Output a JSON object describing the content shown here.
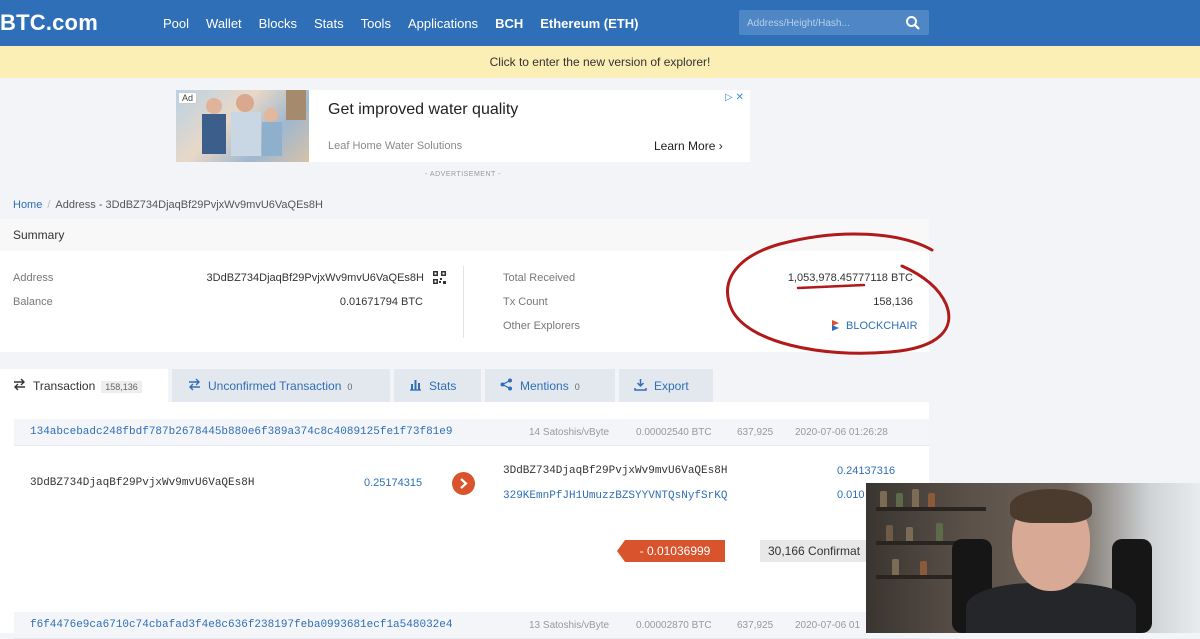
{
  "logo": "BTC.com",
  "nav": [
    {
      "label": "Pool",
      "bold": false
    },
    {
      "label": "Wallet",
      "bold": false
    },
    {
      "label": "Blocks",
      "bold": false
    },
    {
      "label": "Stats",
      "bold": false
    },
    {
      "label": "Tools",
      "bold": false
    },
    {
      "label": "Applications",
      "bold": false
    },
    {
      "label": "BCH",
      "bold": true
    },
    {
      "label": "Ethereum (ETH)",
      "bold": true
    }
  ],
  "search": {
    "placeholder": "Address/Height/Hash..."
  },
  "banner": "Click to enter the new version of explorer!",
  "ad": {
    "tag": "Ad",
    "headline": "Get improved water quality",
    "source": "Leaf Home Water Solutions",
    "cta": "Learn More",
    "close": "▷ ✕",
    "label": "- ADVERTISEMENT -"
  },
  "breadcrumb": {
    "home": "Home",
    "current": "Address - 3DdBZ734DjaqBf29PvjxWv9mvU6VaQEs8H"
  },
  "summary": {
    "title": "Summary",
    "address_label": "Address",
    "address_value": "3DdBZ734DjaqBf29PvjxWv9mvU6VaQEs8H",
    "balance_label": "Balance",
    "balance_value": "0.01671794 BTC",
    "total_received_label": "Total Received",
    "total_received_value": "1,053,978.45777118 BTC",
    "tx_count_label": "Tx Count",
    "tx_count_value": "158,136",
    "other_explorers_label": "Other Explorers",
    "other_explorers_value": "BLOCKCHAIR"
  },
  "tabs": [
    {
      "label": "Transaction",
      "count": "158,136",
      "active": true
    },
    {
      "label": "Unconfirmed Transaction",
      "count": "0",
      "active": false
    },
    {
      "label": "Stats",
      "count": "",
      "active": false
    },
    {
      "label": "Mentions",
      "count": "0",
      "active": false
    },
    {
      "label": "Export",
      "count": "",
      "active": false
    }
  ],
  "transactions": [
    {
      "hash": "134abcebadc248fbdf787b2678445b880e6f389a374c8c4089125fe1f73f81e9",
      "fee_rate": "14 Satoshis/vByte",
      "fee": "0.00002540 BTC",
      "height": "637,925",
      "time": "2020-07-06 01:26:28",
      "input_address": "3DdBZ734DjaqBf29PvjxWv9mvU6VaQEs8H",
      "input_amount": "0.25174315",
      "outputs": [
        {
          "address": "3DdBZ734DjaqBf29PvjxWv9mvU6VaQEs8H",
          "amount": "0.24137316"
        },
        {
          "address": "329KEmnPfJH1UmuzzBZSYYVNTQsNyfSrKQ",
          "amount": "0.010"
        }
      ],
      "balance_change": "- 0.01036999",
      "confirmations": "30,166 Confirmat"
    },
    {
      "hash": "f6f4476e9ca6710c74cbafad3f4e8c636f238197feba0993681ecf1a548032e4",
      "fee_rate": "13 Satoshis/vByte",
      "fee": "0.00002870 BTC",
      "height": "637,925",
      "time": "2020-07-06 01"
    }
  ],
  "colors": {
    "brand": "#2f6fb7",
    "banner": "#fcefb5",
    "negative": "#d9532c",
    "annotation": "#b01a1a"
  }
}
